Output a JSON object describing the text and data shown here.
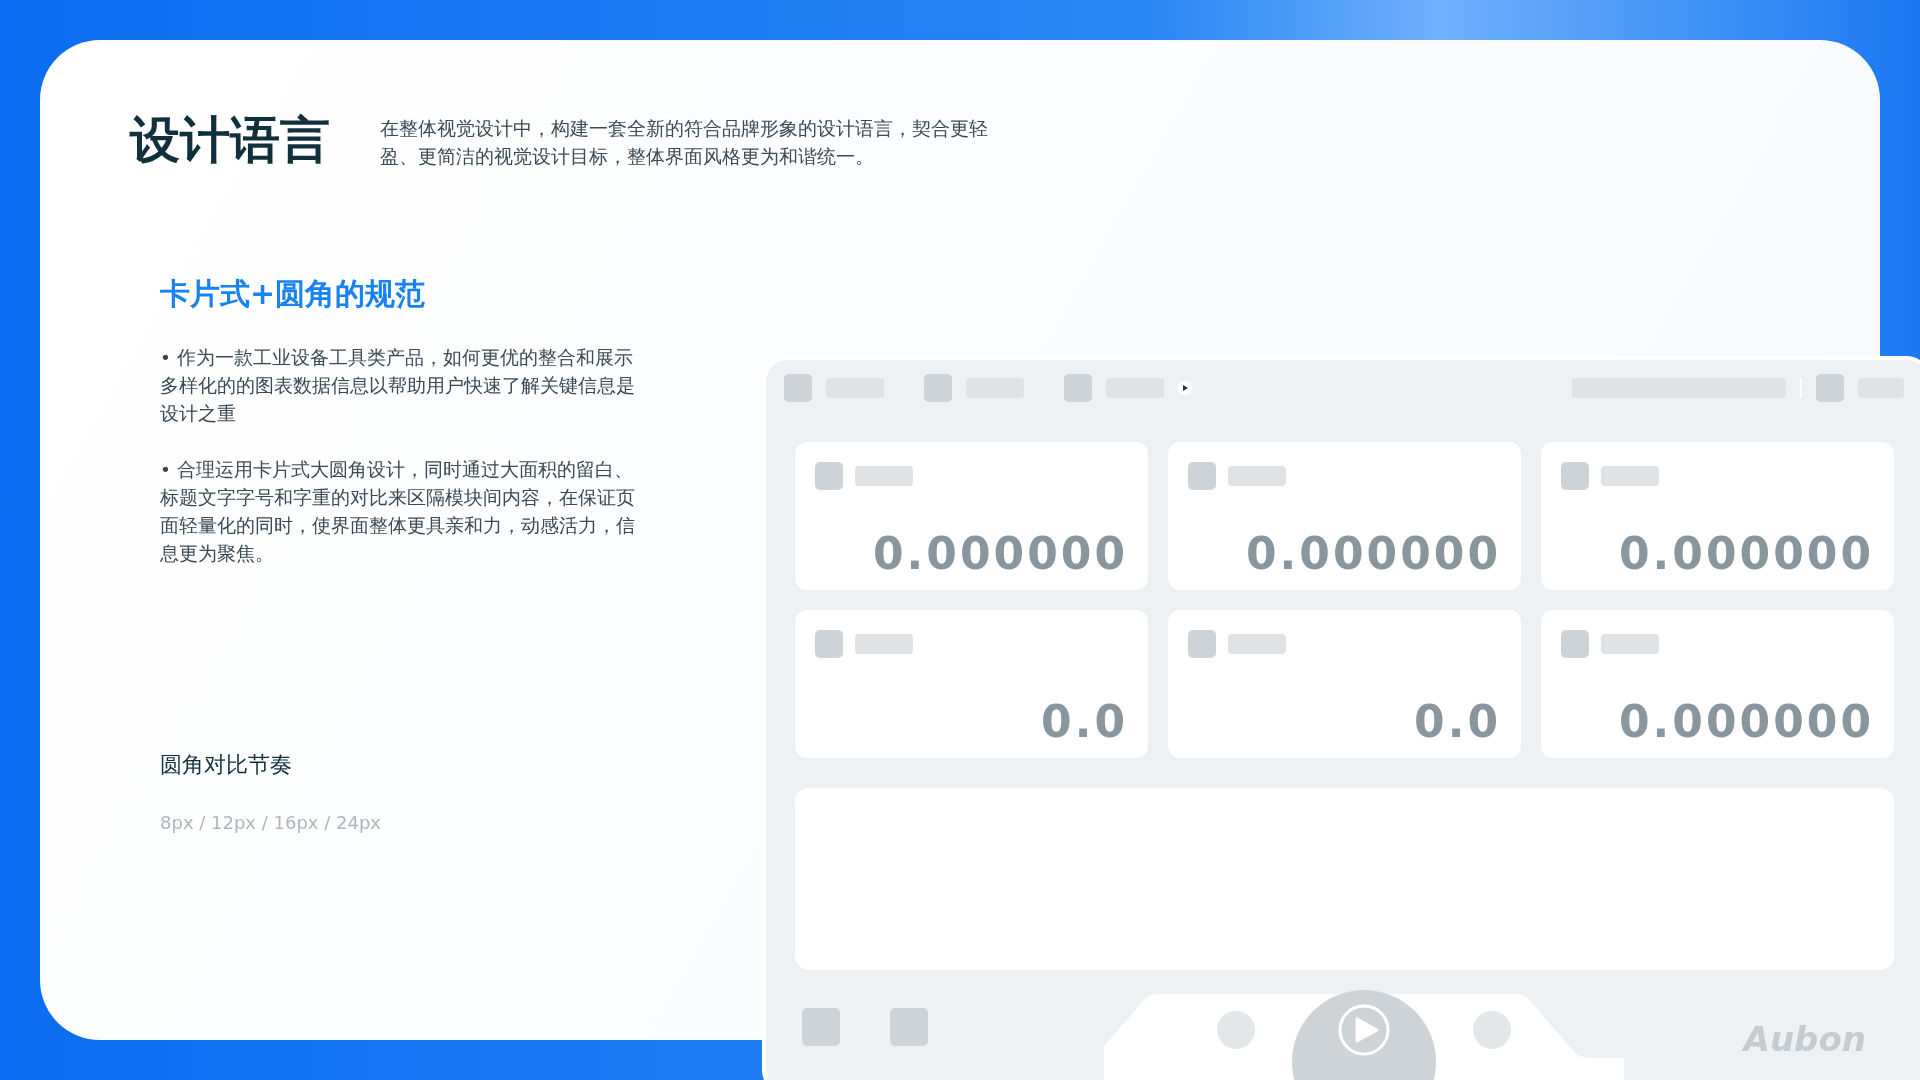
{
  "title": "设计语言",
  "description": "在整体视觉设计中，构建一套全新的符合品牌形象的设计语言，契合更轻盈、更简洁的视觉设计目标，整体界面风格更为和谐统一。",
  "section_title": "卡片式+圆角的规范",
  "bullets": [
    "• 作为一款工业设备工具类产品，如何更优的整合和展示多样化的的图表数据信息以帮助用户快速了解关键信息是设计之重",
    "• 合理运用卡片式大圆角设计，同时通过大面积的留白、标题文字字号和字重的对比来区隔模块间内容，在保证页面轻量化的同时，使界面整体更具亲和力，动感活力，信息更为聚焦。"
  ],
  "rhythm_title": "圆角对比节奏",
  "rhythm_values": "8px / 12px / 16px / 24px",
  "mockup": {
    "cards": [
      {
        "value": "0.000000"
      },
      {
        "value": "0.000000"
      },
      {
        "value": "0.000000"
      },
      {
        "value": "0.0"
      },
      {
        "value": "0.0"
      },
      {
        "value": "0.000000"
      }
    ],
    "logo": "Aubon"
  }
}
